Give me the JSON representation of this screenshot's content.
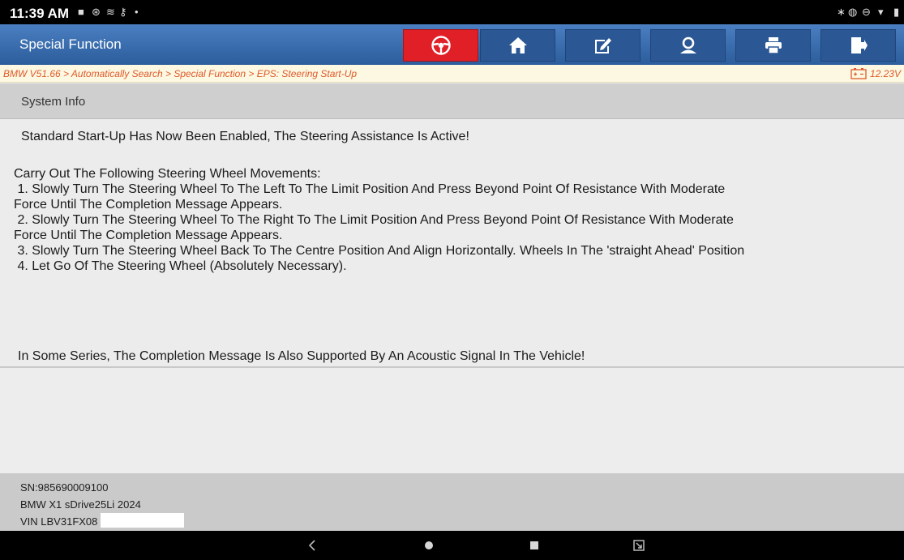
{
  "status_bar": {
    "time": "11:39 AM",
    "left_icons": [
      "gallery-icon",
      "sync-icon",
      "wifi-icon",
      "vpn-icon",
      "dot-icon"
    ],
    "right_icons": [
      "bluetooth-icon",
      "vibrate-icon",
      "dnd-icon",
      "wifi-icon",
      "battery-icon"
    ]
  },
  "app_bar": {
    "title": "Special Function",
    "toolbar": [
      {
        "name": "steering-wheel",
        "icon": "steering-wheel-icon",
        "active": true
      },
      {
        "name": "home",
        "icon": "home-icon"
      },
      {
        "name": "edit",
        "icon": "edit-icon"
      },
      {
        "name": "user",
        "icon": "user-icon"
      },
      {
        "name": "print",
        "icon": "print-icon"
      },
      {
        "name": "exit",
        "icon": "exit-icon"
      }
    ],
    "colors": {
      "bar": "#3a6eb0",
      "active_button": "#e01f27"
    }
  },
  "breadcrumb": {
    "path": "BMW V51.66 > Automatically Search > Special Function > EPS: Steering Start-Up",
    "voltage": "12.23V",
    "voltage_icon": "battery-voltage-icon",
    "text_color": "#e0592a"
  },
  "section": {
    "title": "System Info"
  },
  "message": {
    "headline": "Standard Start-Up Has Now Been Enabled, The Steering Assistance Is Active!",
    "instructions_title": "Carry Out The Following Steering Wheel Movements:",
    "steps": [
      " 1. Slowly Turn The Steering Wheel To The Left To The Limit Position And Press Beyond Point Of Resistance With Moderate",
      "Force Until The Completion Message Appears.",
      " 2. Slowly Turn The Steering Wheel To The Right To The Limit Position And Press Beyond Point Of Resistance With Moderate",
      "Force Until The Completion Message Appears.",
      " 3. Slowly Turn The Steering Wheel Back To The Centre Position And Align Horizontally. Wheels In The 'straight Ahead' Position",
      " 4. Let Go Of The Steering Wheel (Absolutely Necessary)."
    ],
    "footer": "In Some Series, The Completion Message Is Also Supported By An Acoustic Signal In The Vehicle!"
  },
  "vehicle_info": {
    "sn": "SN:985690009100",
    "model": "BMW X1 sDrive25Li 2024",
    "vin": "VIN LBV31FX08"
  },
  "nav_bar": {
    "buttons": [
      "back-icon",
      "home-circle-icon",
      "recents-icon",
      "screenshot-icon"
    ]
  }
}
